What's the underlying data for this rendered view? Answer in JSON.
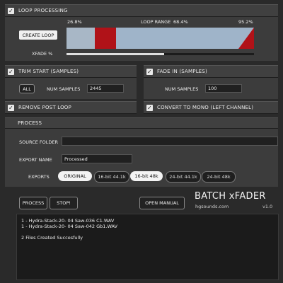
{
  "loop": {
    "header": "LOOP PROCESSING",
    "checked": true,
    "start_pct": "26.8%",
    "range_label": "LOOP RANGE",
    "range_pct": "68.4%",
    "end_pct": "95.2%",
    "create_loop": "CREATE LOOP",
    "xfade_label": "XFADE %",
    "xfade_value": 0.52
  },
  "trim": {
    "header": "TRIM START (SAMPLES)",
    "checked": true,
    "all_label": "ALL",
    "num_samples_label": "NUM SAMPLES",
    "num_samples_value": "2445"
  },
  "fade": {
    "header": "FADE IN (SAMPLES)",
    "checked": true,
    "num_samples_label": "NUM SAMPLES",
    "num_samples_value": "100"
  },
  "remove_post_loop": {
    "header": "REMOVE POST LOOP",
    "checked": true
  },
  "mono": {
    "header": "CONVERT TO MONO (LEFT CHANNEL)",
    "checked": true
  },
  "process": {
    "header": "PROCESS",
    "source_label": "SOURCE FOLDER",
    "export_name_label": "EXPORT NAME",
    "export_name_value": "Processed",
    "exports_label": "EXPORTS",
    "exports": [
      "ORIGINAL",
      "16-bit 44.1k",
      "16-bit 48k",
      "24-bit 44.1k",
      "24-bit 48k"
    ],
    "process_btn": "PROCESS",
    "stop_btn": "STOP!",
    "open_manual_btn": "OPEN MANUAL"
  },
  "brand": {
    "title": "BATCH xFADER",
    "site": "hgsounds.com",
    "version": "v1.0"
  },
  "log": {
    "lines": [
      "1 - Hydra-Stack-20- 04 Saw-036 C1.WAV",
      "1 - Hydra-Stack-20- 04 Saw-042 Gb1.WAV",
      "",
      "2 Files Created Succesfully"
    ]
  },
  "colors": {
    "loop_red": "#b01218",
    "loop_blue": "#9fb4c9",
    "background": "#2a2a2a"
  }
}
